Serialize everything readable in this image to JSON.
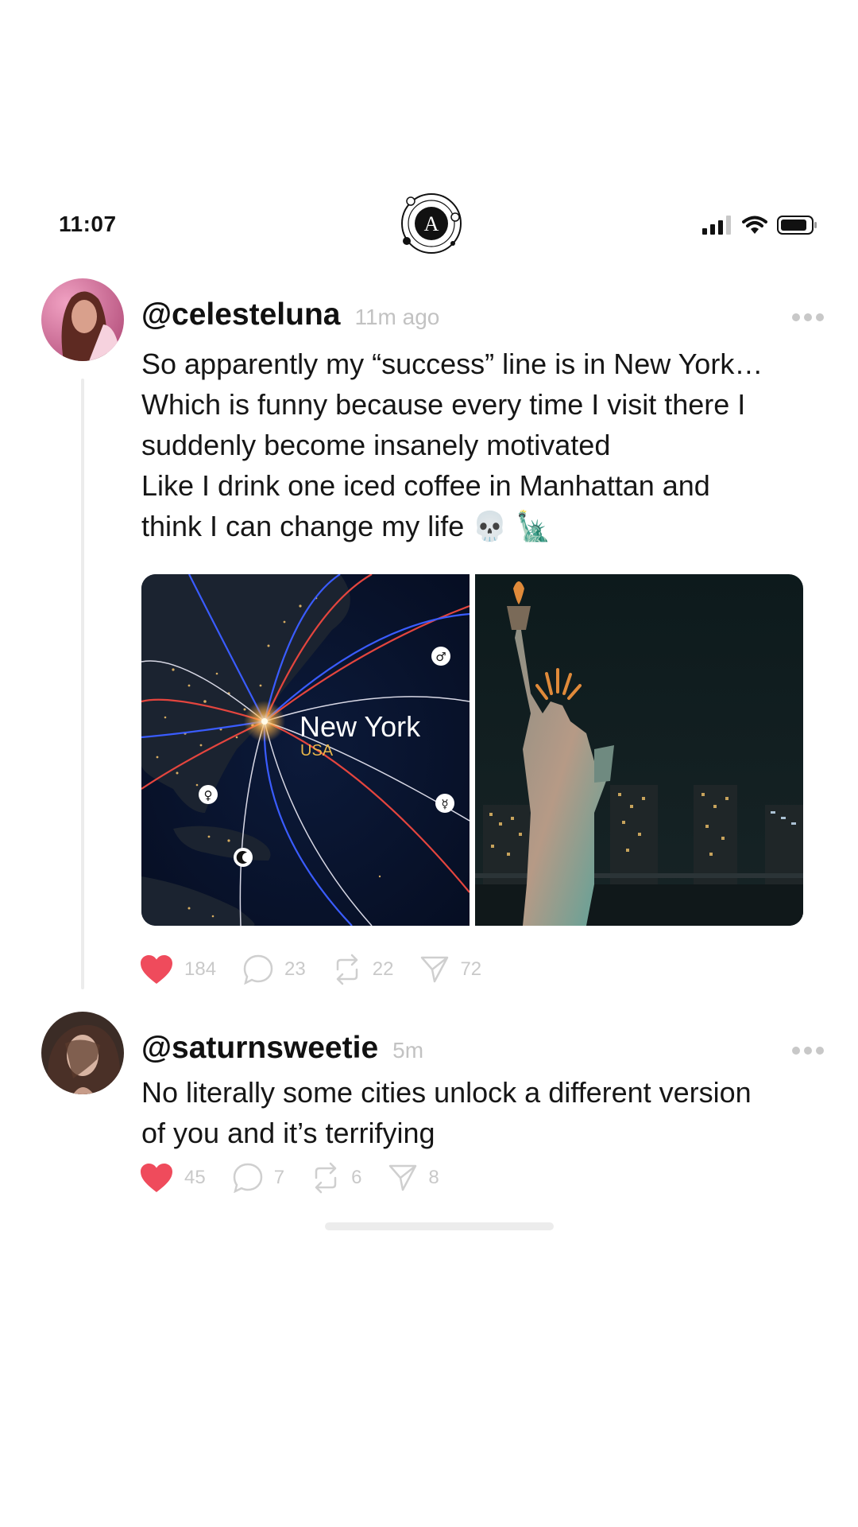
{
  "status_bar": {
    "time": "11:07",
    "icons": [
      "cellular-signal-icon",
      "wifi-icon",
      "battery-icon"
    ]
  },
  "app": {
    "logo_letter": "A"
  },
  "colors": {
    "like": "#ef4b5c",
    "muted": "#c9c9c9",
    "text": "#161616",
    "orbit_red": "#e4453e",
    "orbit_blue": "#3a5cff"
  },
  "posts": [
    {
      "username": "@celesteluna",
      "time_ago": "11m ago",
      "lines": [
        "So apparently my “success” line is in New York…",
        "Which is funny because every time I visit there I",
        "suddenly become insanely motivated",
        "Like I drink one iced coffee in Manhattan and",
        "think I can change my life 💀 🗽"
      ],
      "media": {
        "map_city": "New York",
        "map_country": "USA"
      },
      "stats": {
        "likes": "184",
        "comments": "23",
        "reposts": "22",
        "shares": "72"
      }
    },
    {
      "username": "@saturnsweetie",
      "time_ago": "5m",
      "lines": [
        "No literally some cities unlock a different version",
        "of you and it’s terrifying"
      ],
      "stats": {
        "likes": "45",
        "comments": "7",
        "reposts": "6",
        "shares": "8"
      }
    }
  ]
}
